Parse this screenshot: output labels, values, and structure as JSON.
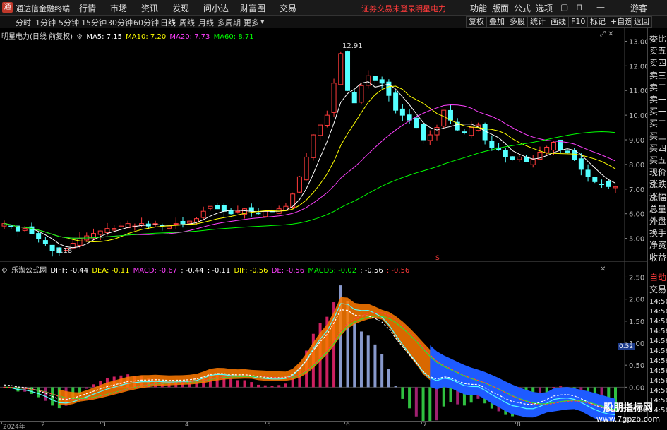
{
  "titlebar": {
    "app_title": "通达信金融终端",
    "menus": [
      "行情",
      "市场",
      "资讯",
      "发现",
      "问小达",
      "财富圈",
      "交易"
    ],
    "notice": "证券交易未登录",
    "stock_name": "明星电力",
    "right_menus": [
      "功能",
      "版面",
      "公式",
      "选项"
    ],
    "guest": "游客"
  },
  "toolbar": {
    "periods": [
      "分时",
      "1分钟",
      "5分钟",
      "15分钟",
      "30分钟",
      "60分钟",
      "日线",
      "周线",
      "月线",
      "多周期",
      "更多"
    ],
    "active_period": "日线",
    "right_buttons": [
      "复权",
      "叠加",
      "多股",
      "统计",
      "画线",
      "F10",
      "标记",
      "+自选",
      "返回"
    ]
  },
  "main_legend": {
    "stock": "明星电力(日线 前复权)",
    "ma5": "MA5: 7.15",
    "ma10": "MA10: 7.20",
    "ma20": "MA20: 7.73",
    "ma60": "MA60: 8.71",
    "high_label": "12.91",
    "low_label": "4.18",
    "marker": "S"
  },
  "sub_legend": {
    "name": "乐淘公式网",
    "diff": "DIFF: -0.44",
    "dea": "DEA: -0.11",
    "macd": "MACD: -0.67",
    "v1": ": -0.44",
    "v2": ": -0.11",
    "dif": "DIF: -0.56",
    "de": "DE: -0.56",
    "macds": "MACDS: -0.02",
    "v3": ": -0.56",
    "v4": ": -0.56",
    "last_value_badge": "0.52"
  },
  "price_axis": [
    "13.00",
    "12.00",
    "11.00",
    "10.00",
    "9.00",
    "8.00",
    "7.00",
    "6.00",
    "5.00"
  ],
  "sub_axis": [
    "2.50",
    "2.00",
    "1.50",
    "1.00",
    "0.50",
    "0.00",
    "-0.50"
  ],
  "sub_axis_dates": [
    "14:56",
    "14:56",
    "14:56",
    "14:56",
    "14:56",
    "14:56",
    "14:56",
    "14:56",
    "14:56",
    "14:56",
    "14:56",
    "14:56"
  ],
  "side_panel": [
    "委比",
    "卖五",
    "卖四",
    "卖三",
    "卖二",
    "卖一",
    "买一",
    "买二",
    "买三",
    "买四",
    "买五",
    "现价",
    "涨跌",
    "涨幅",
    "总量",
    "外盘",
    "换手",
    "净资",
    "收益"
  ],
  "side_panel_sub": [
    "自动",
    "交易"
  ],
  "date_axis": [
    "2024年",
    "2",
    "3",
    "4",
    "5",
    "6",
    "7",
    "8"
  ],
  "watermark": {
    "line1": "股朋指标网",
    "line2": "www.7gpzb.com"
  },
  "colors": {
    "up": "#ff3b3b",
    "down": "#54ffff",
    "ma5": "#ffffff",
    "ma10": "#ffff00",
    "ma20": "#ff40ff",
    "ma60": "#00ff00",
    "orange": "#ff7a00",
    "blue": "#1e5bff"
  },
  "chart_data": {
    "type": "candlestick",
    "title": "明星电力(日线 前复权)",
    "ylim": [
      4.0,
      13.3
    ],
    "close_series_approx": [
      5.6,
      5.5,
      5.3,
      5.4,
      5.2,
      5.0,
      4.8,
      4.5,
      4.4,
      4.6,
      4.8,
      5.0,
      5.1,
      5.2,
      5.3,
      5.4,
      5.4,
      5.5,
      5.6,
      5.5,
      5.6,
      5.5,
      5.6,
      5.5,
      5.5,
      5.6,
      5.6,
      5.7,
      5.8,
      6.1,
      6.3,
      6.2,
      6.1,
      6.0,
      6.1,
      6.2,
      6.1,
      6.0,
      6.1,
      6.1,
      6.2,
      6.3,
      6.8,
      7.5,
      8.3,
      9.2,
      9.6,
      10.0,
      11.3,
      12.5,
      11.0,
      10.5,
      11.2,
      11.6,
      11.4,
      11.3,
      10.8,
      10.2,
      10.0,
      9.8,
      9.5,
      9.0,
      9.2,
      9.5,
      10.2,
      9.8,
      9.4,
      9.3,
      9.5,
      9.6,
      9.0,
      8.7,
      8.6,
      8.3,
      8.2,
      8.3,
      8.1,
      8.2,
      8.5,
      8.7,
      8.9,
      8.6,
      8.5,
      8.2,
      7.8,
      7.5,
      7.3,
      7.2,
      7.1,
      7.1
    ],
    "ma5": 7.15,
    "ma10": 7.2,
    "ma20": 7.73,
    "ma60": 8.71,
    "high": 12.91,
    "low": 4.18
  }
}
